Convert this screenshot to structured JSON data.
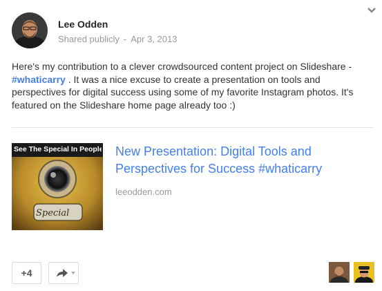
{
  "post": {
    "author": "Lee Odden",
    "visibility": "Shared publicly",
    "separator": "-",
    "date": "Apr 3, 2013",
    "text_before": "Here's my contribution to a clever crowdsourced content project on Slideshare - ",
    "hashtag": "#whaticarry",
    "text_after": " . It was a nice excuse to create a presentation on tools and perspectives for digital success using some of my favorite Instagram photos.  It's featured on the Slideshare home page already too :)"
  },
  "link_preview": {
    "thumbnail_caption": "See The Special In People.",
    "thumbnail_script": "Special",
    "title": "New Presentation: Digital Tools and Perspectives for Success #whaticarry",
    "domain": "leeodden.com"
  },
  "actions": {
    "plus_label": "+4",
    "share_icon": "share-arrow-icon",
    "menu_icon": "chevron-down-icon"
  },
  "colors": {
    "link": "#427fed",
    "meta": "#999999"
  }
}
